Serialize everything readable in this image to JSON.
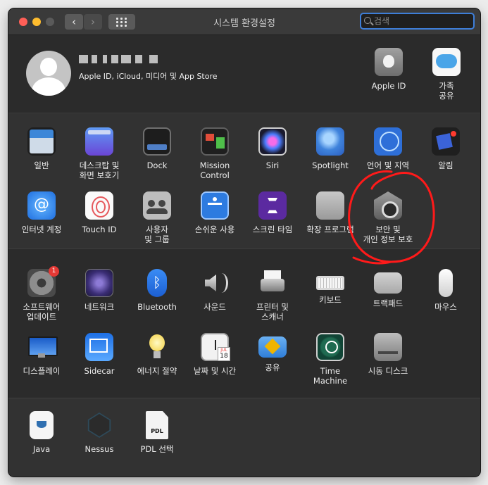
{
  "window": {
    "title": "시스템 환경설정"
  },
  "search": {
    "placeholder": "검색"
  },
  "user": {
    "subtitle": "Apple ID, iCloud, 미디어 및 App Store"
  },
  "top_prefs": [
    {
      "id": "apple-id",
      "label": "Apple ID"
    },
    {
      "id": "family-sharing",
      "label": "가족\n공유"
    }
  ],
  "row1": [
    {
      "label": "일반"
    },
    {
      "label": "데스크탑 및\n화면 보호기"
    },
    {
      "label": "Dock"
    },
    {
      "label": "Mission\nControl"
    },
    {
      "label": "Siri"
    },
    {
      "label": "Spotlight"
    },
    {
      "label": "언어 및 지역"
    },
    {
      "label": "알림"
    }
  ],
  "row2": [
    {
      "label": "인터넷 계정"
    },
    {
      "label": "Touch ID"
    },
    {
      "label": "사용자\n및 그룹"
    },
    {
      "label": "손쉬운 사용"
    },
    {
      "label": "스크린 타임"
    },
    {
      "label": "확장 프로그램"
    },
    {
      "label": "보안 및\n개인 정보 보호"
    }
  ],
  "row3": [
    {
      "label": "소프트웨어\n업데이트",
      "badge": "1"
    },
    {
      "label": "네트워크"
    },
    {
      "label": "Bluetooth"
    },
    {
      "label": "사운드"
    },
    {
      "label": "프린터 및\n스캐너"
    },
    {
      "label": "키보드"
    },
    {
      "label": "트랙패드"
    },
    {
      "label": "마우스"
    }
  ],
  "row4": [
    {
      "label": "디스플레이"
    },
    {
      "label": "Sidecar"
    },
    {
      "label": "에너지 절약"
    },
    {
      "label": "날짜 및 시간"
    },
    {
      "label": "공유"
    },
    {
      "label": "Time\nMachine"
    },
    {
      "label": "시동 디스크"
    }
  ],
  "row5": [
    {
      "label": "Java"
    },
    {
      "label": "Nessus"
    },
    {
      "label": "PDL 선택"
    }
  ],
  "date_icon": {
    "month": "JUL",
    "day": "18"
  },
  "colors": {
    "annotation": "#ff1a1a",
    "search_focus": "#3e7ed8",
    "badge": "#e53935"
  }
}
